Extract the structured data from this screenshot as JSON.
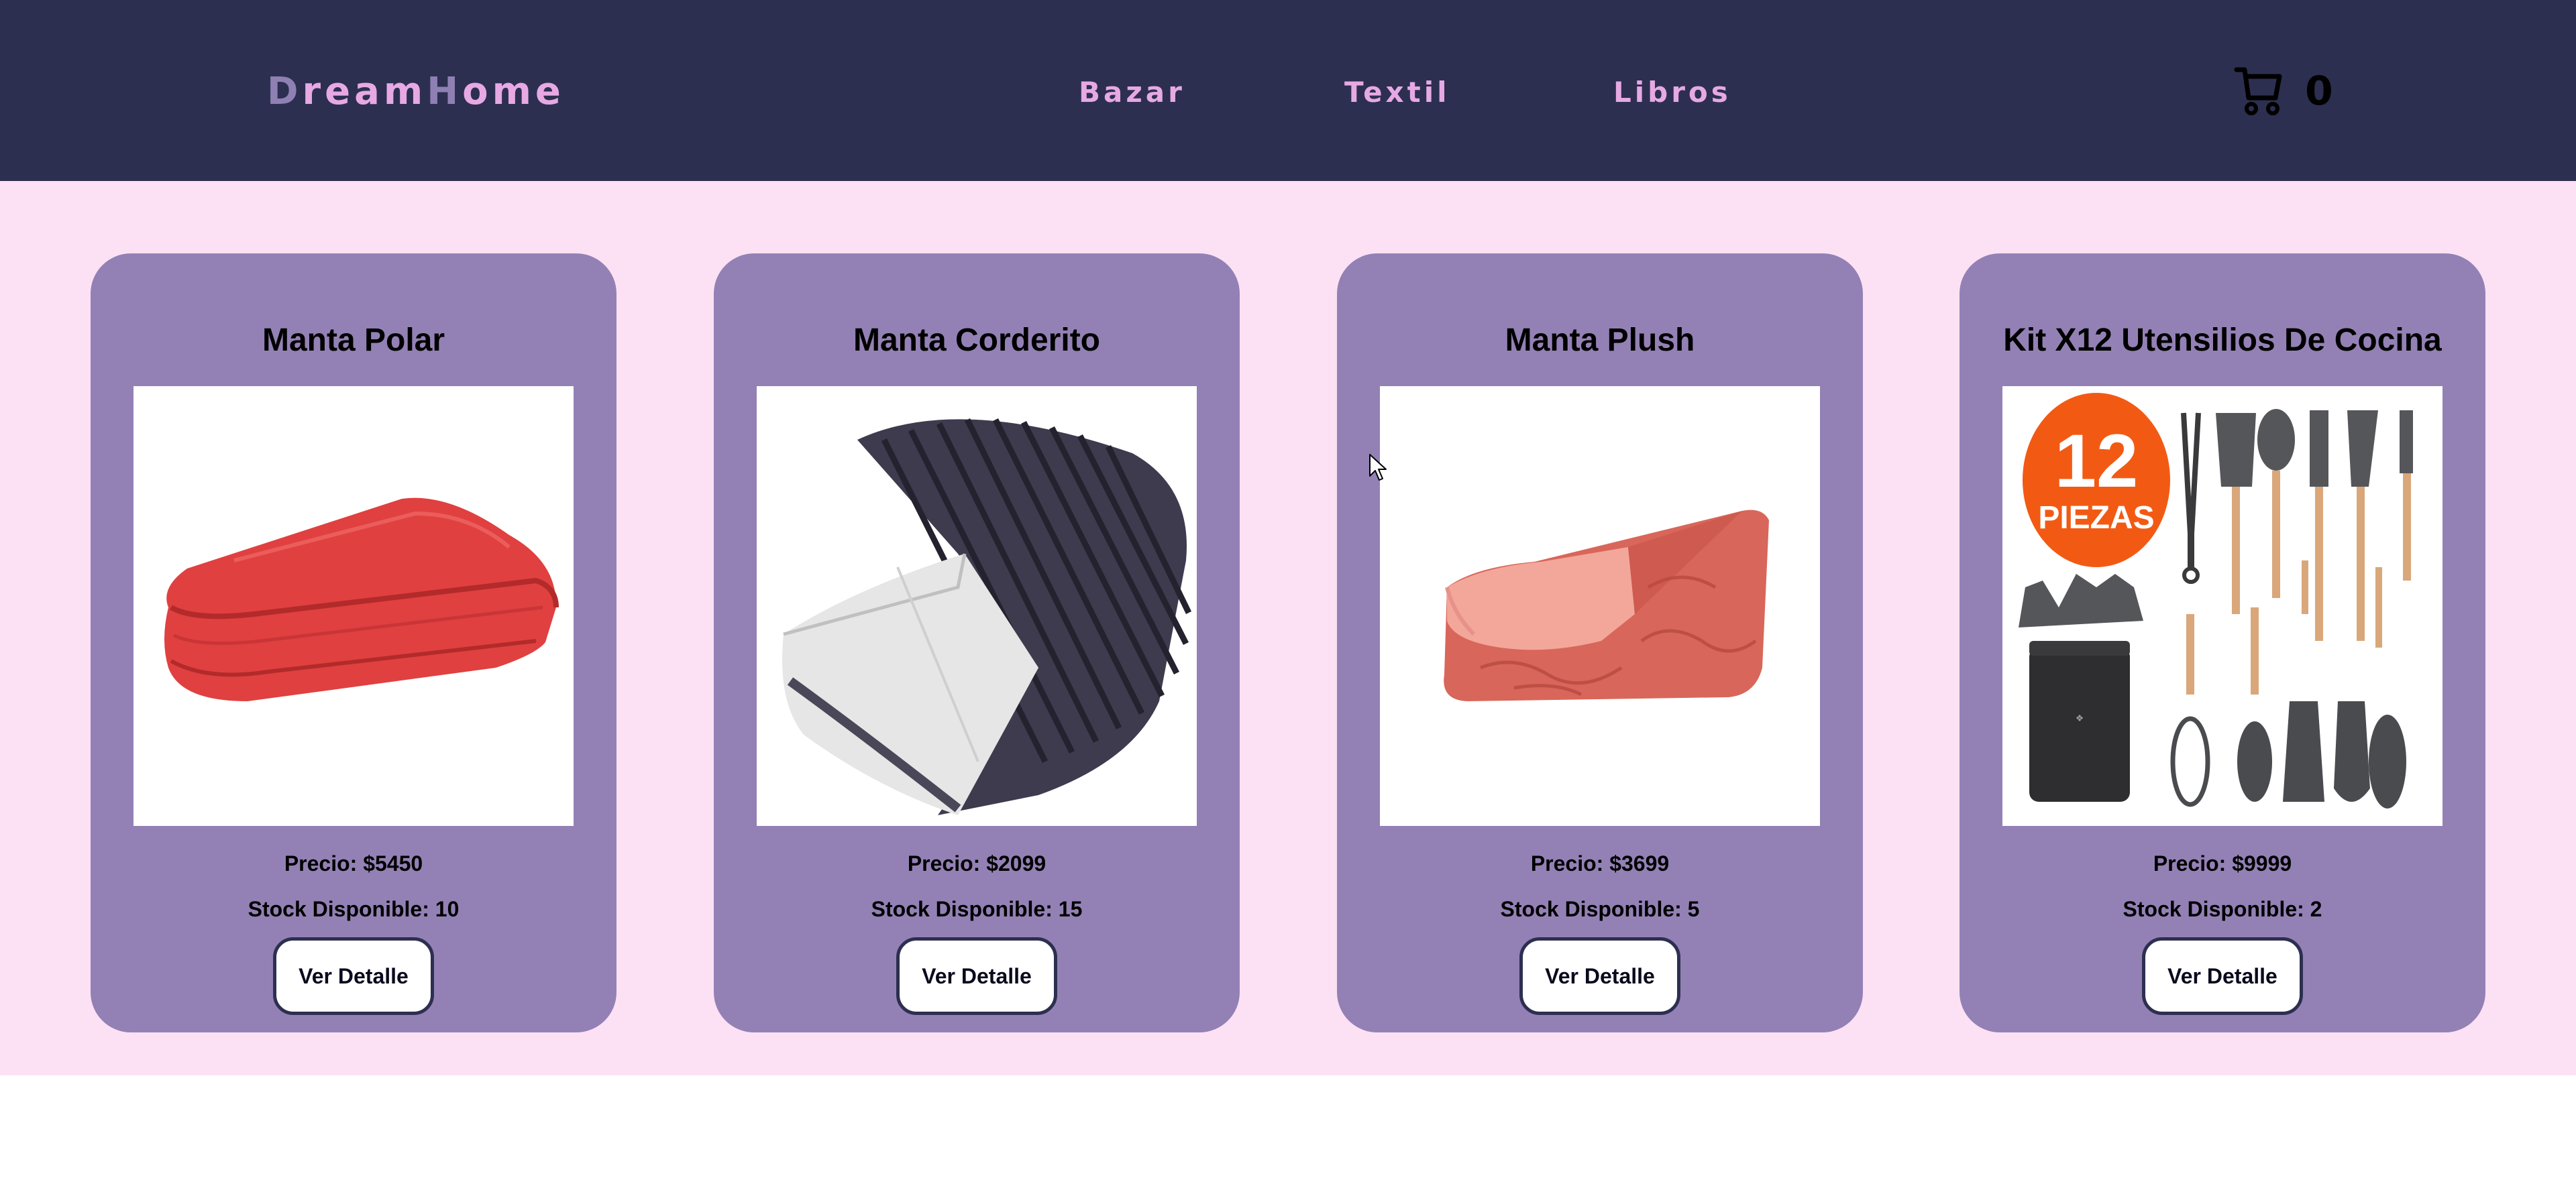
{
  "header": {
    "brand": {
      "segments": [
        {
          "text": "D",
          "color": "#8f80b4"
        },
        {
          "text": "ream",
          "color": "#e6a9e4"
        },
        {
          "text": "H",
          "color": "#8f80b4"
        },
        {
          "text": "ome",
          "color": "#e6a9e4"
        }
      ]
    },
    "nav": [
      {
        "label": "Bazar"
      },
      {
        "label": "Textil"
      },
      {
        "label": "Libros"
      }
    ],
    "cart": {
      "icon": "shopping-cart-icon",
      "count": "0"
    }
  },
  "products": [
    {
      "title": "Manta Polar",
      "image": "red-folded-fleece-blanket",
      "price": "Precio: $5450",
      "stock": "Stock Disponible: 10",
      "button": "Ver Detalle"
    },
    {
      "title": "Manta Corderito",
      "image": "rolled-dark-grey-corduroy-sherpa-blanket",
      "price": "Precio: $2099",
      "stock": "Stock Disponible: 15",
      "button": "Ver Detalle"
    },
    {
      "title": "Manta Plush",
      "image": "folded-coral-and-peach-plush-blanket",
      "price": "Precio: $3699",
      "stock": "Stock Disponible: 5",
      "button": "Ver Detalle"
    },
    {
      "title": "Kit X12 Utensilios De Cocina",
      "image": "grey-silicone-kitchen-utensils-set",
      "image_badge": [
        "12",
        "PIEZAS"
      ],
      "price": "Precio: $9999",
      "stock": "Stock Disponible: 2",
      "button": "Ver Detalle"
    }
  ],
  "colors": {
    "header_bg": "#2d2f50",
    "nav_text": "#e6a9e4",
    "page_bg": "#fce1f4",
    "card_bg": "#9381b5",
    "button_border": "#2d2f50"
  }
}
